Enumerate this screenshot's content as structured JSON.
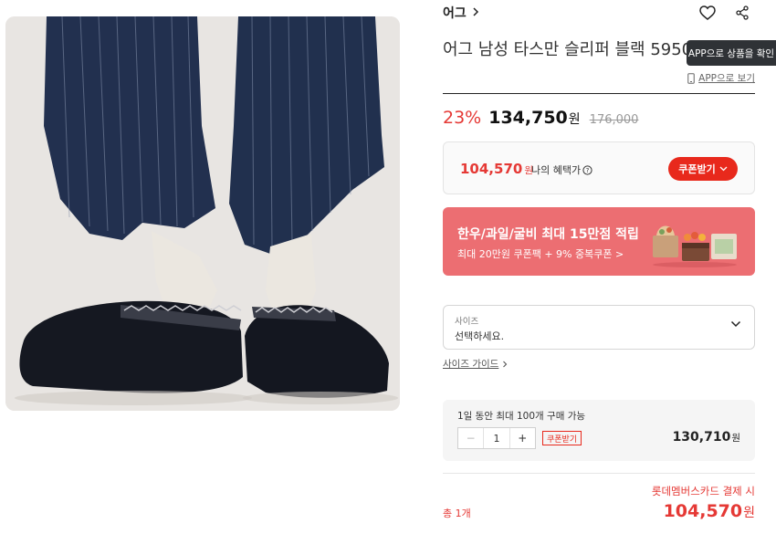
{
  "product": {
    "brand": "어그",
    "title": "어그 남성 타스만 슬리퍼 블랙 5950"
  },
  "app": {
    "tooltip": "APP으로 상품을 확인",
    "link": "APP으로 보기"
  },
  "price": {
    "discount": "23%",
    "sale": "134,750",
    "sale_unit": "원",
    "original": "176,000"
  },
  "benefit": {
    "price": "104,570",
    "unit": "원",
    "label": "나의 혜택가",
    "coupon_button": "쿠폰받기"
  },
  "banner": {
    "title": "한우/과일/굴비 최대 15만점 적립",
    "subtitle": "최대 20만원 쿠폰팩 + 9% 중복쿠폰 >",
    "color": "#ec6e72"
  },
  "size": {
    "label": "사이즈",
    "placeholder": "선택하세요.",
    "guide": "사이즈 가이드"
  },
  "quantity": {
    "limit_text": "1일 동안 최대 100개 구매 가능",
    "count": "1",
    "coupon_tag": "쿠폰받기",
    "price": "130,710",
    "unit": "원"
  },
  "total": {
    "card_note": "롯데멤버스카드 결제 시",
    "count_label": "총 1개",
    "price": "104,570",
    "unit": "원"
  },
  "colors": {
    "accent": "#e53935",
    "button": "#e8291c"
  }
}
